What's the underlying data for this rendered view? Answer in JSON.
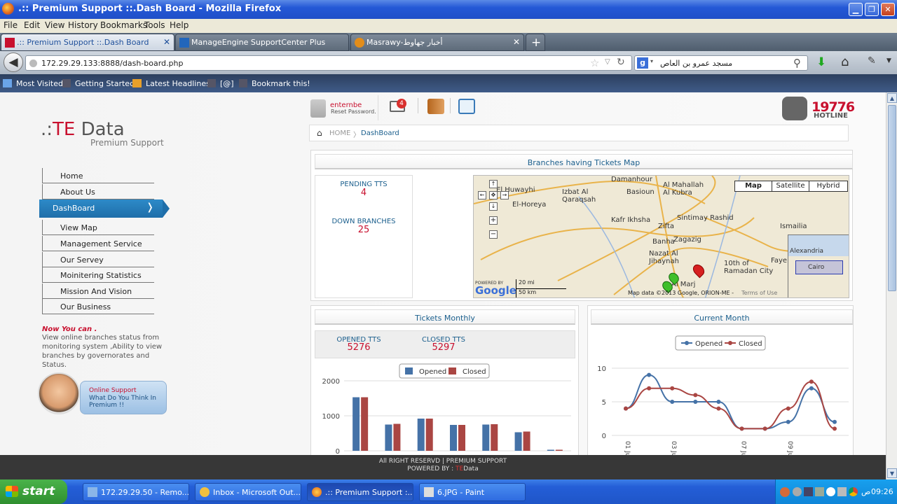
{
  "window": {
    "title": ".:: Premium Support ::.Dash Board - Mozilla Firefox"
  },
  "menubar": [
    "File",
    "Edit",
    "View",
    "History",
    "Bookmarks",
    "Tools",
    "Help"
  ],
  "tabs": [
    {
      "label": ".:: Premium Support ::.Dash Board",
      "active": true
    },
    {
      "label": "ManageEngine SupportCenter Plus",
      "active": false
    },
    {
      "label": "Masrawy-أخبار جهاوط",
      "active": false
    }
  ],
  "nav": {
    "url": "172.29.29.133:8888/dash-board.php",
    "search": "مسجد عمرو بن العاص"
  },
  "bookmarks": [
    "Most Visited",
    "Getting Started",
    "Latest Headlines",
    "[@]",
    "Bookmark this!"
  ],
  "brand": {
    "logo": ".:TE Data",
    "logo_te": "TE",
    "logo_rest": " Data",
    "logo_sub": "Premium Support"
  },
  "sidebar": {
    "items": [
      "Home",
      "About Us",
      "DashBoard",
      "View Map",
      "Management Service",
      "Our Servey",
      "Moinitering Statistics",
      "Mission And Vision",
      "Our Business"
    ],
    "active_index": 2,
    "now_title": "Now You can .",
    "now_text": "View online branches status from monitoring system ,Ability to view branches by governorates and Status.",
    "support_title": "Online Support",
    "support_sub": "What Do You Think In Premium !!"
  },
  "header": {
    "user": "enternbe",
    "reset": "Reset Password.",
    "notif_count": "4",
    "hotline_num": "19776",
    "hotline_label": "HOTLINE"
  },
  "breadcrumb": {
    "home": "HOME",
    "current": "DashBoard"
  },
  "map_panel": {
    "title": "Branches having Tickets Map",
    "pending_label": "PENDING TTS",
    "pending_value": "4",
    "down_label": "DOWN BRANCHES",
    "down_value": "25",
    "buttons": [
      "Map",
      "Satellite",
      "Hybrid"
    ],
    "places": [
      "Damanhour",
      "El Huwayhi",
      "Izbat Al Qaraqsah",
      "El-Horeya",
      "Basioun",
      "Al Mahallah Al Kubra",
      "Kafr Ikhsha",
      "Zifta",
      "Sintimay Rashid",
      "Ismailia",
      "Banha",
      "Zagazig",
      "Nazat Al Jihaynah",
      "10th of Ramadan City",
      "Al Marj",
      "Alexandria",
      "Cairo",
      "Faye"
    ],
    "scale_mi": "20 mi",
    "scale_km": "50 km",
    "attribution": "Map data ©2013 Google, ORION-ME -",
    "terms": "Terms of Use",
    "powered": "POWERED BY",
    "google": "Google"
  },
  "tickets_monthly": {
    "title": "Tickets Monthly",
    "opened_label": "OPENED TTS",
    "opened_value": "5276",
    "closed_label": "CLOSED TTS",
    "closed_value": "5297"
  },
  "current_month": {
    "title": "Current Month"
  },
  "chart_data": [
    {
      "type": "bar",
      "legend": [
        "Opened",
        "Closed"
      ],
      "series": [
        {
          "name": "Opened",
          "values": [
            1530,
            750,
            920,
            740,
            750,
            530,
            30
          ]
        },
        {
          "name": "Closed",
          "values": [
            1530,
            770,
            920,
            740,
            760,
            550,
            30
          ]
        }
      ],
      "yticks": [
        "0",
        "1000",
        "2000"
      ],
      "ylim": [
        0,
        2000
      ],
      "colors": {
        "Opened": "#4572a7",
        "Closed": "#aa4643"
      }
    },
    {
      "type": "line",
      "legend": [
        "Opened",
        "Closed"
      ],
      "x": [
        1,
        2,
        3,
        4,
        5,
        6,
        7,
        8,
        9,
        10
      ],
      "series": [
        {
          "name": "Opened",
          "values": [
            4,
            9,
            5,
            5,
            5,
            1,
            1,
            2,
            7,
            2
          ]
        },
        {
          "name": "Closed",
          "values": [
            4,
            7,
            7,
            6,
            4,
            1,
            1,
            4,
            8,
            1
          ]
        }
      ],
      "yticks": [
        "0",
        "5",
        "10"
      ],
      "xticks": [
        "01 Jul",
        "03 Jul",
        "07 Jul",
        "09 Jul"
      ],
      "ylim": [
        0,
        10
      ],
      "colors": {
        "Opened": "#4572a7",
        "Closed": "#aa4643"
      }
    }
  ],
  "footer": {
    "line1": "All RIGHT RESERVD | PREMIUM SUPPORT",
    "line2_prefix": "POWERED BY : ",
    "line2_te": "TE",
    "line2_rest": "Data"
  },
  "taskbar": {
    "start": "start",
    "items": [
      "172.29.29.50 - Remo...",
      "Inbox - Microsoft Out...",
      ".:: Premium Support :...",
      "6.JPG - Paint"
    ],
    "clock": "09:26",
    "ampm": "ص"
  }
}
